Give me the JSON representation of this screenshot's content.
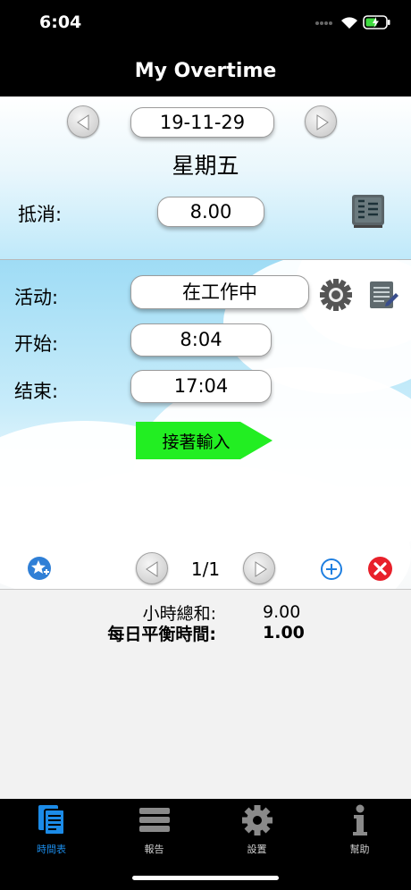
{
  "status": {
    "time": "6:04"
  },
  "nav": {
    "title": "My Overtime"
  },
  "date": {
    "value": "19-11-29",
    "weekday": "星期五"
  },
  "offset": {
    "label": "抵消:",
    "value": "8.00"
  },
  "activity": {
    "label": "活动:",
    "value": "在工作中"
  },
  "start": {
    "label": "开始:",
    "value": "8:04"
  },
  "end": {
    "label": "结束:",
    "value": "17:04"
  },
  "next_button": {
    "label": "接著輸入"
  },
  "pager": {
    "text": "1/1"
  },
  "summary": {
    "total_label": "小時總和:",
    "total_value": "9.00",
    "balance_label": "每日平衡時間:",
    "balance_value": "1.00"
  },
  "tabs": [
    {
      "label": "時間表",
      "icon": "timesheet-icon",
      "active": true
    },
    {
      "label": "報告",
      "icon": "report-icon",
      "active": false
    },
    {
      "label": "設置",
      "icon": "settings-gear-icon",
      "active": false
    },
    {
      "label": "幫助",
      "icon": "info-icon",
      "active": false
    }
  ],
  "colors": {
    "accent_tab": "#1b8be8",
    "next_green": "#22ee22",
    "delete_red": "#e8202a",
    "add_blue": "#1f7fe0"
  }
}
